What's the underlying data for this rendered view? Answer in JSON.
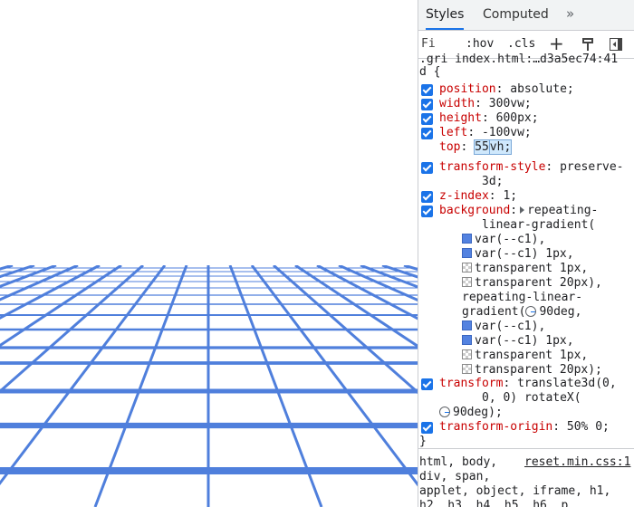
{
  "devtools": {
    "tabs": [
      {
        "label": "Styles",
        "active": true
      },
      {
        "label": "Computed",
        "active": false
      }
    ],
    "more_tabs_glyph": "»",
    "toolbar": {
      "filter_placeholder": "Fi",
      "hov_label": ":hov",
      "cls_label": ".cls",
      "add_label": "+",
      "icons": [
        "new-style-rule-icon",
        "paint-format-icon",
        "toggle-sidebar-icon"
      ]
    },
    "rule": {
      "selector_header": ".gri index.html:…d3a5ec74:41",
      "selector": "d {",
      "close_brace": "}",
      "declarations": [
        {
          "property": "position",
          "value": "absolute;",
          "checked": true
        },
        {
          "property": "width",
          "value": "300vw;",
          "checked": true
        },
        {
          "property": "height",
          "value": "600px;",
          "checked": true
        },
        {
          "property": "left",
          "value": "-100vw;",
          "checked": true
        },
        {
          "property": "top",
          "value_sel": "55",
          "value_rest": "vh;",
          "checked": false,
          "editing": true
        },
        {
          "property": "transform-style",
          "value": "preserve-",
          "value_cont": "3d;",
          "checked": true
        },
        {
          "property": "z-index",
          "value": "1;",
          "checked": true
        },
        {
          "property": "background",
          "value": "repeating-",
          "checked": true
        },
        {
          "property": "transform",
          "value": "translate3d(0,",
          "checked": true
        },
        {
          "property": "transform-origin",
          "value": "50% 0;",
          "checked": true
        }
      ],
      "background_lines": [
        "linear-gradient(",
        "var(--c1),",
        "var(--c1) 1px,",
        "transparent 1px,",
        "transparent 20px),",
        "repeating-linear-",
        "gradient(",
        "90deg,",
        "var(--c1),",
        "var(--c1) 1px,",
        "transparent 1px,",
        "transparent 20px);"
      ],
      "transform_lines": [
        "0, 0) rotateX(",
        "90deg);"
      ]
    },
    "next_rule": {
      "selector_line1": "html, body,",
      "source": "reset.min.css:1",
      "selector_line2": "div, span,",
      "selector_line3": "applet, object, iframe, h1,",
      "selector_line4": "h2, h3, h4, h5, h6, p,"
    }
  },
  "colors": {
    "grid_line": "#4f7fdc",
    "checkbox": "#1a73e8",
    "property": "#c80000",
    "c1_swatch": "#5382e0"
  }
}
